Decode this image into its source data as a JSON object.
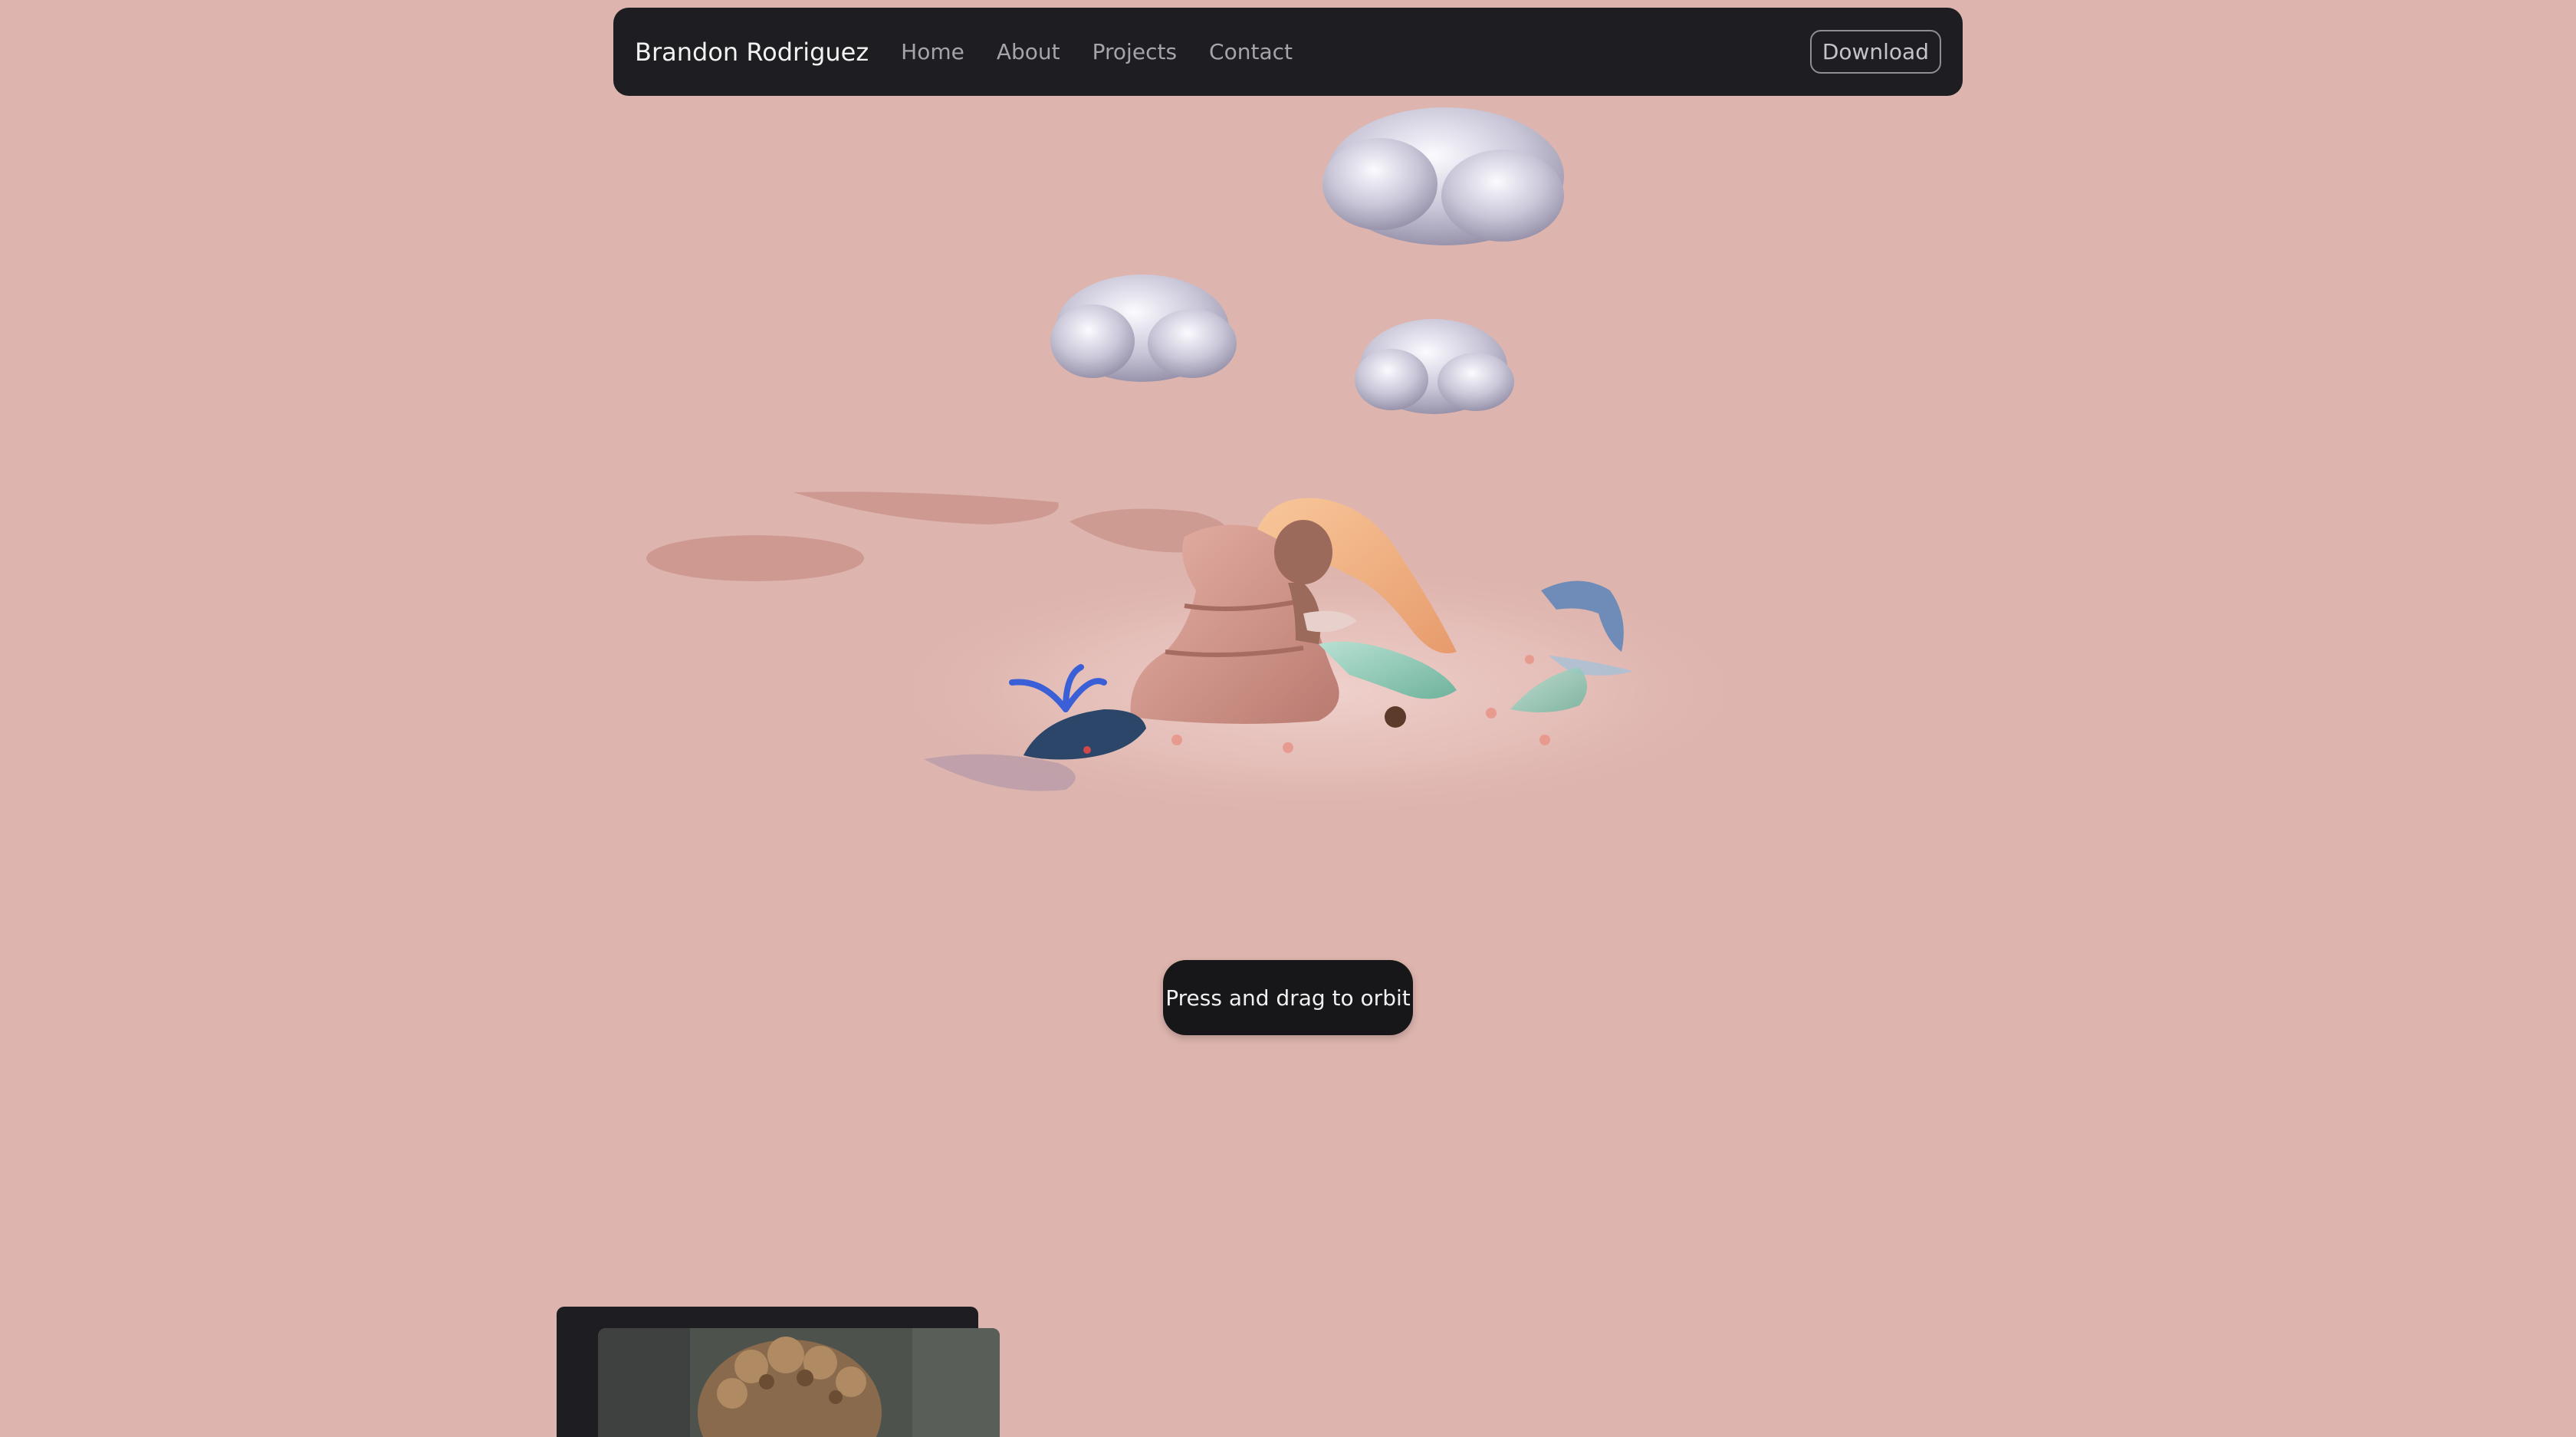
{
  "nav": {
    "brand": "Brandon Rodriguez",
    "links": [
      "Home",
      "About",
      "Projects",
      "Contact"
    ],
    "download_label": "Download"
  },
  "scene": {
    "hint": "Press and drag to orbit"
  },
  "colors": {
    "background": "#deb5ae",
    "navbar": "#1d1d22",
    "hint_pill": "#17171a"
  }
}
